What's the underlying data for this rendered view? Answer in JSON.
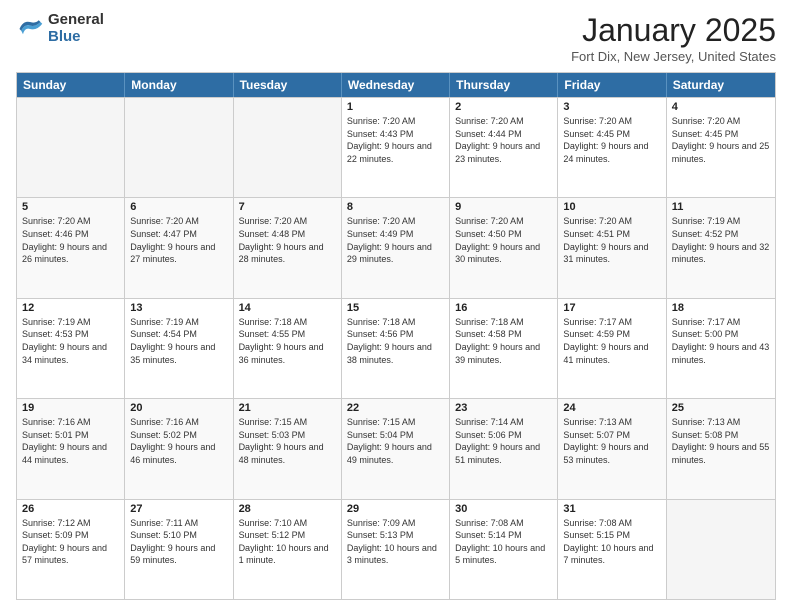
{
  "logo": {
    "general": "General",
    "blue": "Blue"
  },
  "title": {
    "month": "January 2025",
    "location": "Fort Dix, New Jersey, United States"
  },
  "days": [
    "Sunday",
    "Monday",
    "Tuesday",
    "Wednesday",
    "Thursday",
    "Friday",
    "Saturday"
  ],
  "weeks": [
    [
      {
        "day": "",
        "sunrise": "",
        "sunset": "",
        "daylight": "",
        "empty": true
      },
      {
        "day": "",
        "sunrise": "",
        "sunset": "",
        "daylight": "",
        "empty": true
      },
      {
        "day": "",
        "sunrise": "",
        "sunset": "",
        "daylight": "",
        "empty": true
      },
      {
        "day": "1",
        "sunrise": "Sunrise: 7:20 AM",
        "sunset": "Sunset: 4:43 PM",
        "daylight": "Daylight: 9 hours and 22 minutes.",
        "empty": false
      },
      {
        "day": "2",
        "sunrise": "Sunrise: 7:20 AM",
        "sunset": "Sunset: 4:44 PM",
        "daylight": "Daylight: 9 hours and 23 minutes.",
        "empty": false
      },
      {
        "day": "3",
        "sunrise": "Sunrise: 7:20 AM",
        "sunset": "Sunset: 4:45 PM",
        "daylight": "Daylight: 9 hours and 24 minutes.",
        "empty": false
      },
      {
        "day": "4",
        "sunrise": "Sunrise: 7:20 AM",
        "sunset": "Sunset: 4:45 PM",
        "daylight": "Daylight: 9 hours and 25 minutes.",
        "empty": false
      }
    ],
    [
      {
        "day": "5",
        "sunrise": "Sunrise: 7:20 AM",
        "sunset": "Sunset: 4:46 PM",
        "daylight": "Daylight: 9 hours and 26 minutes.",
        "empty": false
      },
      {
        "day": "6",
        "sunrise": "Sunrise: 7:20 AM",
        "sunset": "Sunset: 4:47 PM",
        "daylight": "Daylight: 9 hours and 27 minutes.",
        "empty": false
      },
      {
        "day": "7",
        "sunrise": "Sunrise: 7:20 AM",
        "sunset": "Sunset: 4:48 PM",
        "daylight": "Daylight: 9 hours and 28 minutes.",
        "empty": false
      },
      {
        "day": "8",
        "sunrise": "Sunrise: 7:20 AM",
        "sunset": "Sunset: 4:49 PM",
        "daylight": "Daylight: 9 hours and 29 minutes.",
        "empty": false
      },
      {
        "day": "9",
        "sunrise": "Sunrise: 7:20 AM",
        "sunset": "Sunset: 4:50 PM",
        "daylight": "Daylight: 9 hours and 30 minutes.",
        "empty": false
      },
      {
        "day": "10",
        "sunrise": "Sunrise: 7:20 AM",
        "sunset": "Sunset: 4:51 PM",
        "daylight": "Daylight: 9 hours and 31 minutes.",
        "empty": false
      },
      {
        "day": "11",
        "sunrise": "Sunrise: 7:19 AM",
        "sunset": "Sunset: 4:52 PM",
        "daylight": "Daylight: 9 hours and 32 minutes.",
        "empty": false
      }
    ],
    [
      {
        "day": "12",
        "sunrise": "Sunrise: 7:19 AM",
        "sunset": "Sunset: 4:53 PM",
        "daylight": "Daylight: 9 hours and 34 minutes.",
        "empty": false
      },
      {
        "day": "13",
        "sunrise": "Sunrise: 7:19 AM",
        "sunset": "Sunset: 4:54 PM",
        "daylight": "Daylight: 9 hours and 35 minutes.",
        "empty": false
      },
      {
        "day": "14",
        "sunrise": "Sunrise: 7:18 AM",
        "sunset": "Sunset: 4:55 PM",
        "daylight": "Daylight: 9 hours and 36 minutes.",
        "empty": false
      },
      {
        "day": "15",
        "sunrise": "Sunrise: 7:18 AM",
        "sunset": "Sunset: 4:56 PM",
        "daylight": "Daylight: 9 hours and 38 minutes.",
        "empty": false
      },
      {
        "day": "16",
        "sunrise": "Sunrise: 7:18 AM",
        "sunset": "Sunset: 4:58 PM",
        "daylight": "Daylight: 9 hours and 39 minutes.",
        "empty": false
      },
      {
        "day": "17",
        "sunrise": "Sunrise: 7:17 AM",
        "sunset": "Sunset: 4:59 PM",
        "daylight": "Daylight: 9 hours and 41 minutes.",
        "empty": false
      },
      {
        "day": "18",
        "sunrise": "Sunrise: 7:17 AM",
        "sunset": "Sunset: 5:00 PM",
        "daylight": "Daylight: 9 hours and 43 minutes.",
        "empty": false
      }
    ],
    [
      {
        "day": "19",
        "sunrise": "Sunrise: 7:16 AM",
        "sunset": "Sunset: 5:01 PM",
        "daylight": "Daylight: 9 hours and 44 minutes.",
        "empty": false
      },
      {
        "day": "20",
        "sunrise": "Sunrise: 7:16 AM",
        "sunset": "Sunset: 5:02 PM",
        "daylight": "Daylight: 9 hours and 46 minutes.",
        "empty": false
      },
      {
        "day": "21",
        "sunrise": "Sunrise: 7:15 AM",
        "sunset": "Sunset: 5:03 PM",
        "daylight": "Daylight: 9 hours and 48 minutes.",
        "empty": false
      },
      {
        "day": "22",
        "sunrise": "Sunrise: 7:15 AM",
        "sunset": "Sunset: 5:04 PM",
        "daylight": "Daylight: 9 hours and 49 minutes.",
        "empty": false
      },
      {
        "day": "23",
        "sunrise": "Sunrise: 7:14 AM",
        "sunset": "Sunset: 5:06 PM",
        "daylight": "Daylight: 9 hours and 51 minutes.",
        "empty": false
      },
      {
        "day": "24",
        "sunrise": "Sunrise: 7:13 AM",
        "sunset": "Sunset: 5:07 PM",
        "daylight": "Daylight: 9 hours and 53 minutes.",
        "empty": false
      },
      {
        "day": "25",
        "sunrise": "Sunrise: 7:13 AM",
        "sunset": "Sunset: 5:08 PM",
        "daylight": "Daylight: 9 hours and 55 minutes.",
        "empty": false
      }
    ],
    [
      {
        "day": "26",
        "sunrise": "Sunrise: 7:12 AM",
        "sunset": "Sunset: 5:09 PM",
        "daylight": "Daylight: 9 hours and 57 minutes.",
        "empty": false
      },
      {
        "day": "27",
        "sunrise": "Sunrise: 7:11 AM",
        "sunset": "Sunset: 5:10 PM",
        "daylight": "Daylight: 9 hours and 59 minutes.",
        "empty": false
      },
      {
        "day": "28",
        "sunrise": "Sunrise: 7:10 AM",
        "sunset": "Sunset: 5:12 PM",
        "daylight": "Daylight: 10 hours and 1 minute.",
        "empty": false
      },
      {
        "day": "29",
        "sunrise": "Sunrise: 7:09 AM",
        "sunset": "Sunset: 5:13 PM",
        "daylight": "Daylight: 10 hours and 3 minutes.",
        "empty": false
      },
      {
        "day": "30",
        "sunrise": "Sunrise: 7:08 AM",
        "sunset": "Sunset: 5:14 PM",
        "daylight": "Daylight: 10 hours and 5 minutes.",
        "empty": false
      },
      {
        "day": "31",
        "sunrise": "Sunrise: 7:08 AM",
        "sunset": "Sunset: 5:15 PM",
        "daylight": "Daylight: 10 hours and 7 minutes.",
        "empty": false
      },
      {
        "day": "",
        "sunrise": "",
        "sunset": "",
        "daylight": "",
        "empty": true
      }
    ]
  ]
}
